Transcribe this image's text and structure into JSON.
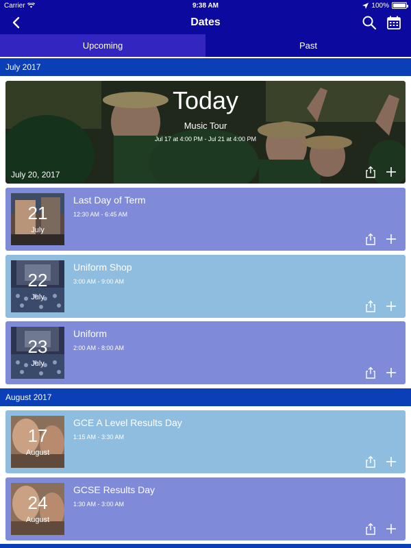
{
  "status_bar": {
    "carrier": "Carrier",
    "time": "9:38 AM",
    "battery": "100%",
    "battery_level": 1.0
  },
  "nav": {
    "title": "Dates",
    "back_icon": "back-chevron-icon",
    "search_icon": "search-icon",
    "calendar_icon": "calendar-icon"
  },
  "tabs": [
    {
      "label": "Upcoming",
      "active": true
    },
    {
      "label": "Past",
      "active": false
    }
  ],
  "sections": [
    {
      "header": "July 2017",
      "featured": {
        "badge": "Today",
        "title": "Music Tour",
        "range": "Jul 17 at 4:00 PM - Jul 21 at 4:00 PM",
        "date": "July 20, 2017"
      },
      "events": [
        {
          "day": "21",
          "month": "July",
          "title": "Last Day of Term",
          "time": "12:30 AM - 6:45 AM",
          "color": "#7f8ad8"
        },
        {
          "day": "22",
          "month": "July",
          "title": "Uniform Shop",
          "time": "3:00 AM - 9:00 AM",
          "color": "#8fbde0"
        },
        {
          "day": "23",
          "month": "July",
          "title": "Uniform",
          "time": "2:00 AM - 8:00 AM",
          "color": "#7f8ad8"
        }
      ]
    },
    {
      "header": "August 2017",
      "events": [
        {
          "day": "17",
          "month": "August",
          "title": "GCE A Level Results Day",
          "time": "1:15 AM - 3:30 AM",
          "color": "#8fbde0"
        },
        {
          "day": "24",
          "month": "August",
          "title": "GCSE Results Day",
          "time": "1:30 AM - 3:00 AM",
          "color": "#7f8ad8"
        }
      ]
    }
  ],
  "colors": {
    "nav": "#0c0a9e",
    "active_tab": "#3225c0",
    "section_header": "#0a3fb8",
    "card_purple": "#7f8ad8",
    "card_blue": "#8fbde0"
  }
}
